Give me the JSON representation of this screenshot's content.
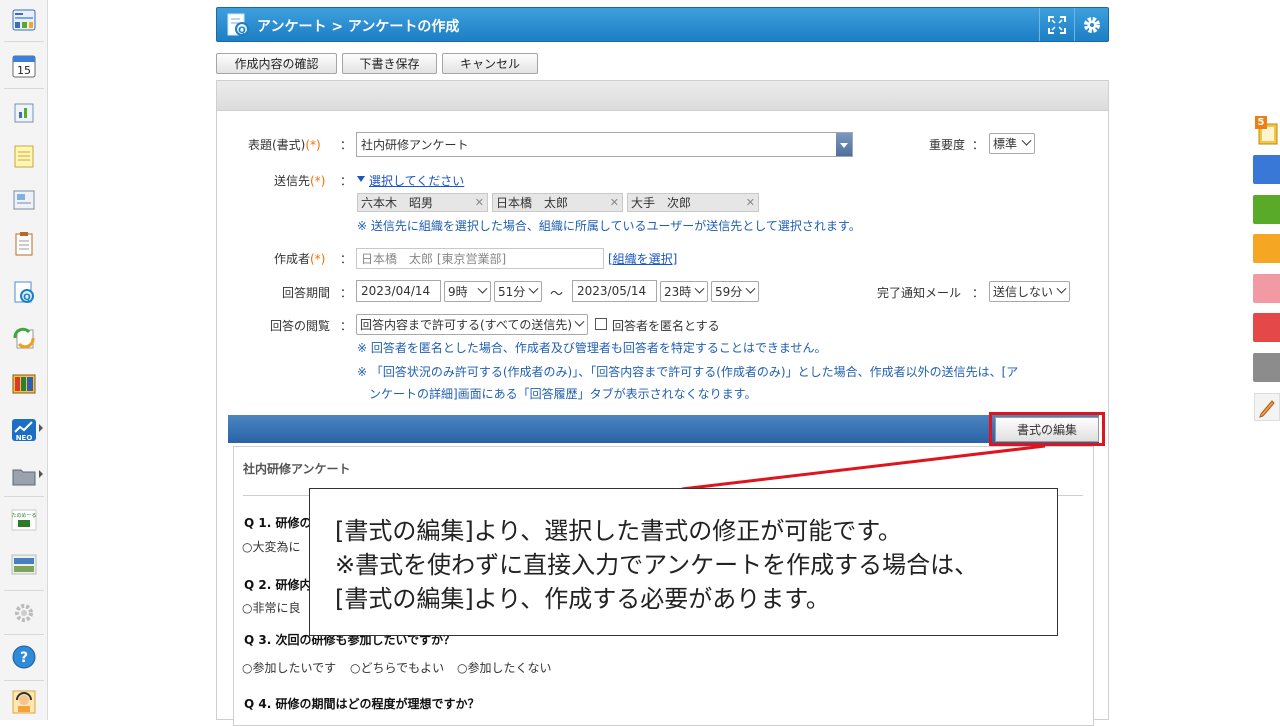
{
  "window": {
    "title": "アンケート > アンケートの作成"
  },
  "toolbar": {
    "confirm_label": "作成内容の確認",
    "draft_label": "下書き保存",
    "cancel_label": "キャンセル"
  },
  "form": {
    "subject": {
      "label": "表題(書式)",
      "required_mark": "(*)",
      "value": "社内研修アンケート"
    },
    "priority": {
      "label": "重要度",
      "value": "標準"
    },
    "recipients": {
      "label": "送信先",
      "required_mark": "(*)",
      "select_link": "選択してください",
      "chips": [
        "六本木　昭男",
        "日本橋　太郎",
        "大手　次郎"
      ],
      "note": "※ 送信先に組織を選択した場合、組織に所属しているユーザーが送信先として選択されます。"
    },
    "author": {
      "label": "作成者",
      "required_mark": "(*)",
      "value": "日本橋　太郎 [東京営業部]",
      "org_link": "[組織を選択]"
    },
    "period": {
      "label": "回答期間",
      "start_date": "2023/04/14",
      "start_hour": "9時",
      "start_min": "51分",
      "tilde": "～",
      "end_date": "2023/05/14",
      "end_hour": "23時",
      "end_min": "59分"
    },
    "notify": {
      "label": "完了通知メール",
      "value": "送信しない"
    },
    "viewing": {
      "label": "回答の閲覧",
      "value": "回答内容まで許可する(すべての送信先)",
      "anon_label": "回答者を匿名とする",
      "note1": "※ 回答者を匿名とした場合、作成者及び管理者も回答者を特定することはできません。",
      "note2_line1": "※ 「回答状況のみ許可する(作成者のみ)」、「回答内容まで許可する(作成者のみ)」とした場合、作成者以外の送信先は、[ア",
      "note2_line2": "ンケートの詳細]画面にある「回答履歴」タブが表示されなくなります。"
    }
  },
  "edit_button_label": "書式の編集",
  "preview": {
    "title": "社内研修アンケート",
    "q1": "Q 1. 研修の",
    "q1_opt": "○大変為に",
    "q2": "Q 2. 研修内",
    "q2_opt": "○非常に良",
    "q3": "Q 3. 次回の研修も参加したいですか？",
    "q3_opts": [
      "参加したいです",
      "どちらでもよい",
      "参加したくない"
    ],
    "q4": "Q 4. 研修の期間はどの程度が理想ですか？"
  },
  "callout": {
    "line1": "[書式の編集]より、選択した書式の修正が可能です。",
    "line2": "※書式を使わずに直接入力でアンケートを作成する場合は、",
    "line3": "[書式の編集]より、作成する必要があります。"
  },
  "colors": {
    "accent": "#1d7fc4",
    "required": "#ff6a00",
    "highlight": "#e0141c",
    "section": "#2a63a5"
  },
  "rail": {
    "right_badge": "5",
    "right_tab_colors": [
      "#3a78d8",
      "#5aaa2a",
      "#f5a623",
      "#f29aa4",
      "#e54848",
      "#8c8c8c"
    ]
  }
}
